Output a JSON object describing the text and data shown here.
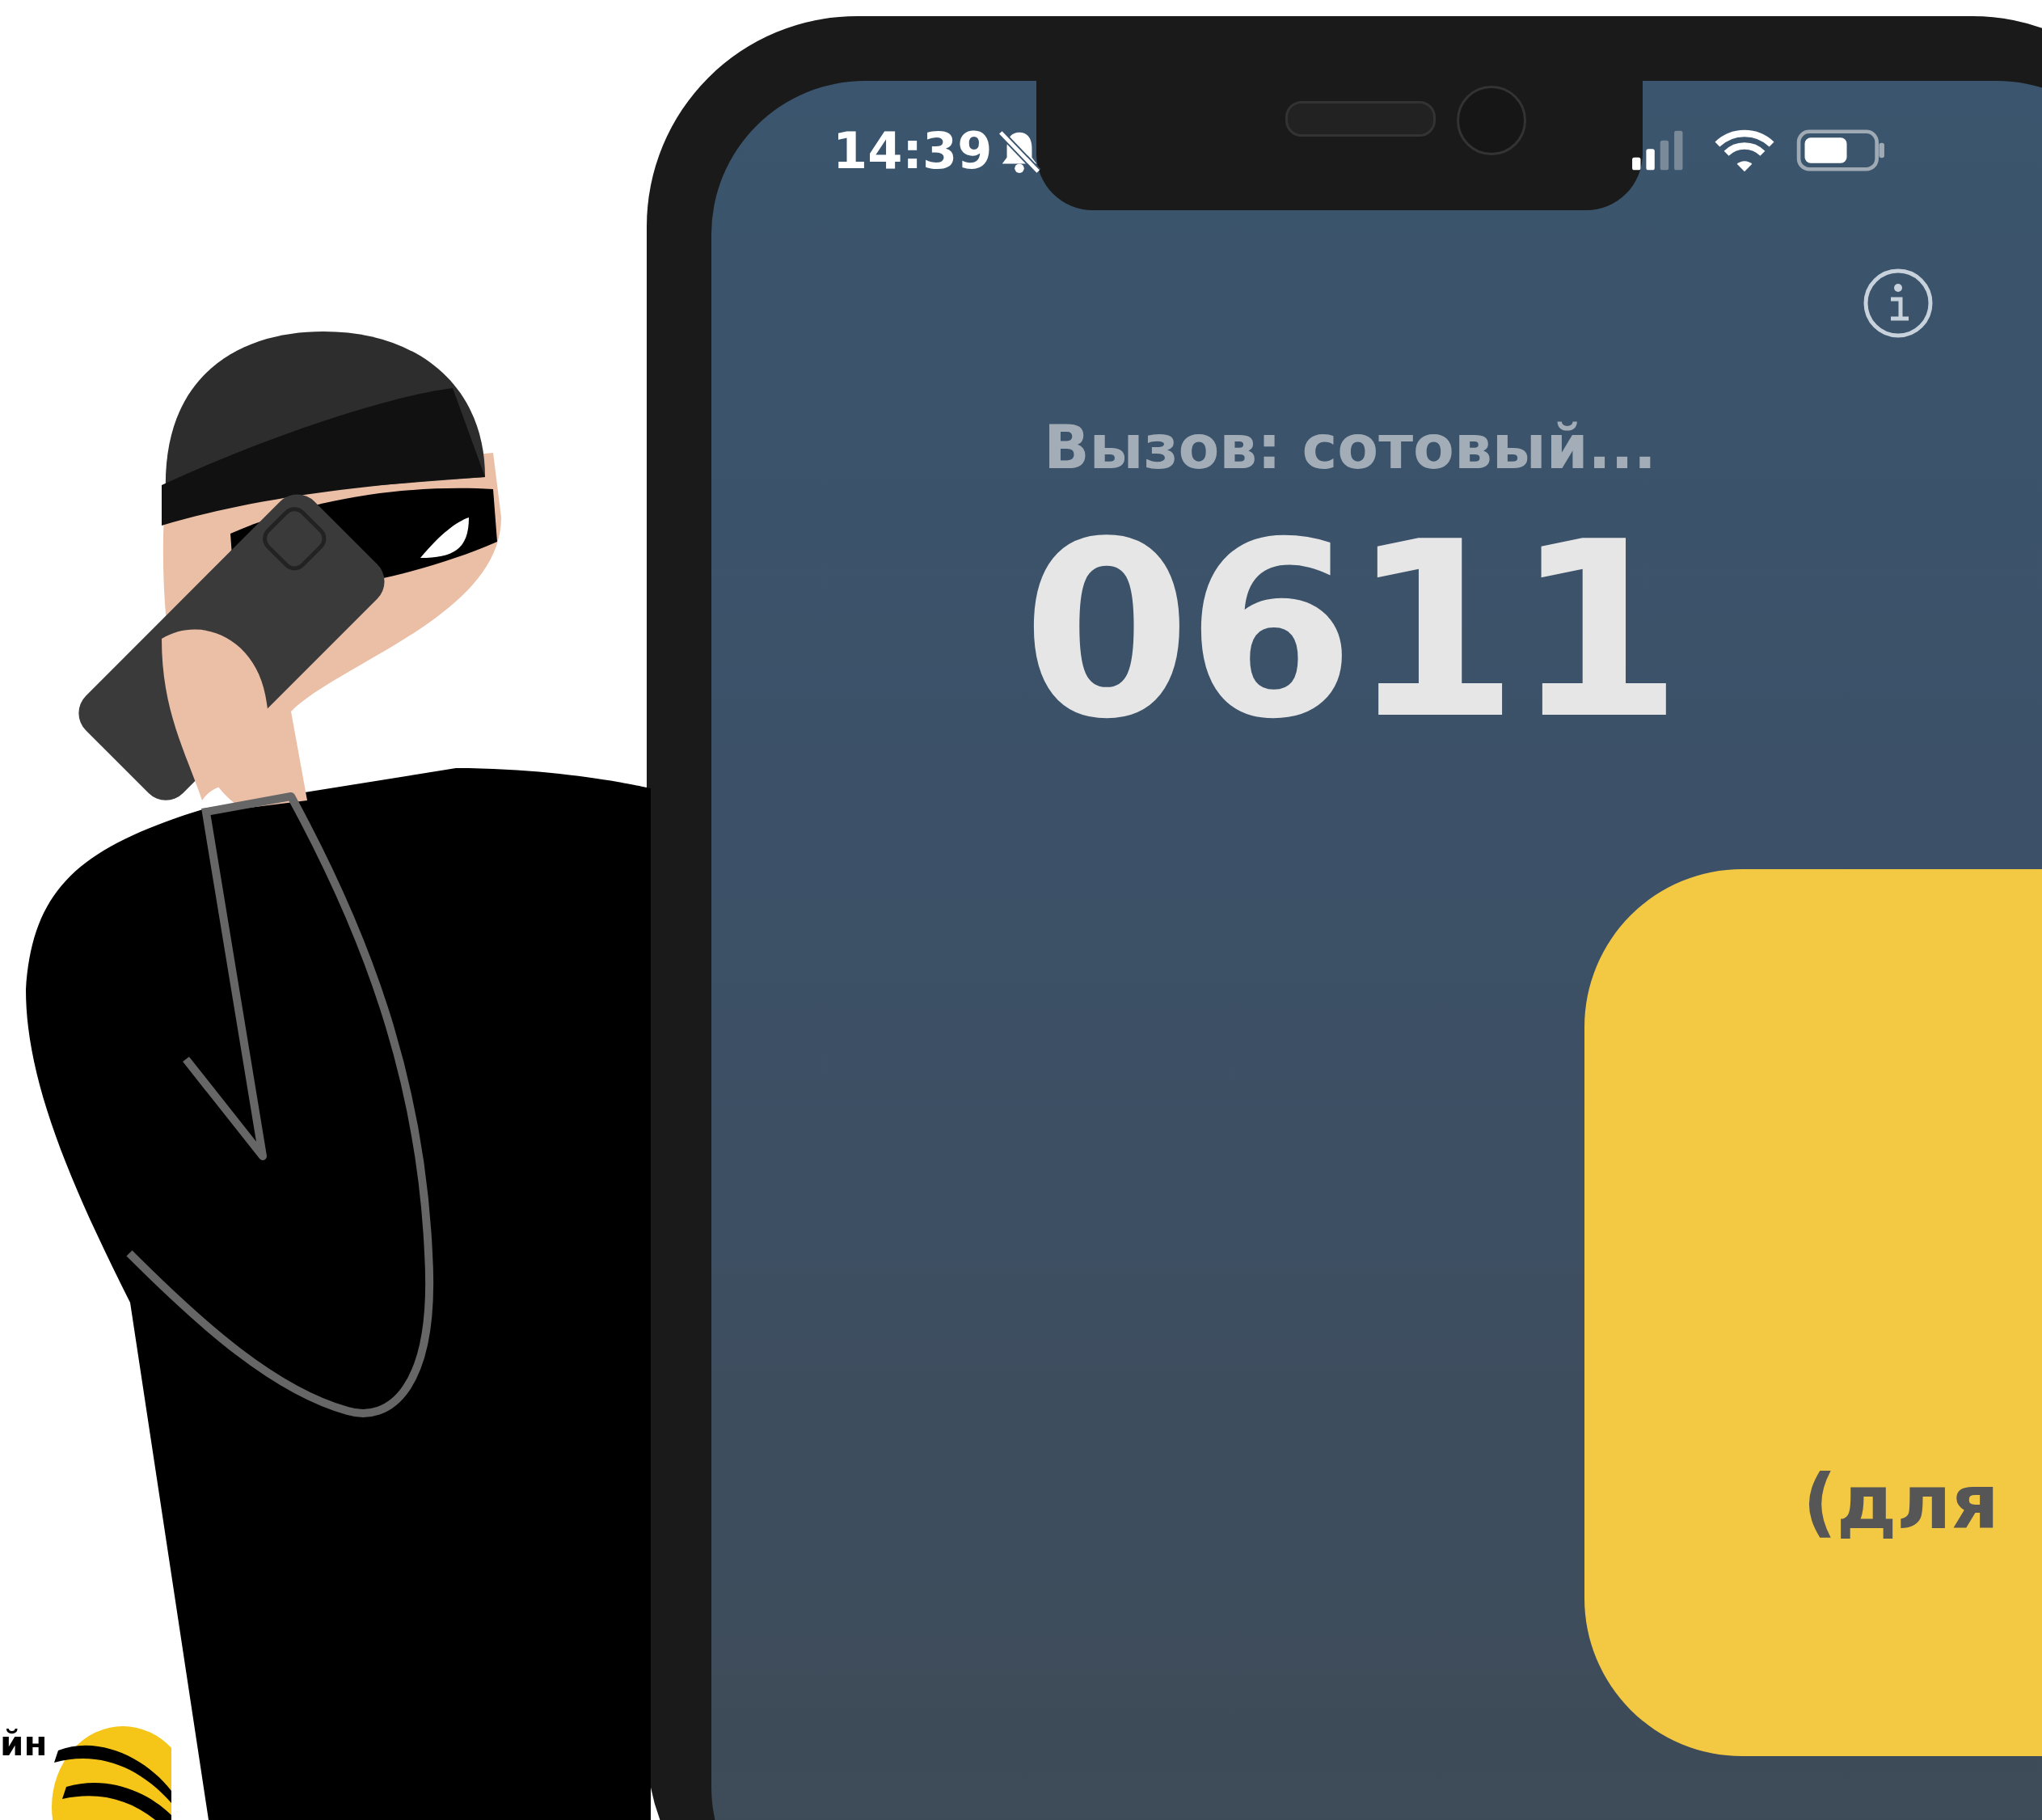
{
  "status_bar": {
    "time": "14:39",
    "silent": true
  },
  "call": {
    "status": "Вызов: сотовый...",
    "number": "0611"
  },
  "card": {
    "text": "(для"
  },
  "logo": {
    "text": "йн"
  }
}
